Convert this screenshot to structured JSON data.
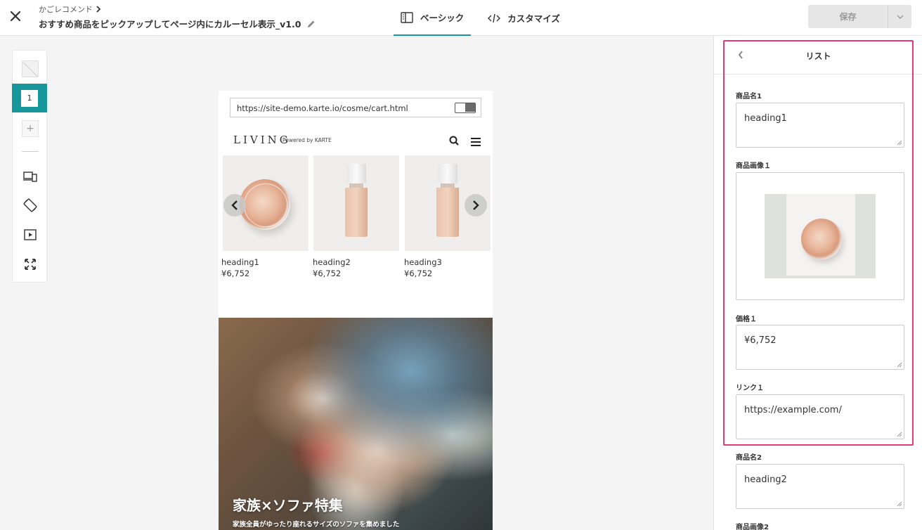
{
  "header": {
    "breadcrumb": "かごレコメンド",
    "title": "おすすめ商品をピックアップしてページ内にカルーセル表示_v1.0",
    "tabs": [
      {
        "label": "ベーシック",
        "icon": "layout-icon",
        "active": true
      },
      {
        "label": "カスタマイズ",
        "icon": "code-icon",
        "active": false
      }
    ],
    "save_label": "保存"
  },
  "left_toolbar": {
    "active_variant": "1",
    "tools": [
      "device-icon",
      "rotate-icon",
      "play-icon",
      "expand-icon"
    ]
  },
  "preview": {
    "url": "https://site-demo.karte.io/cosme/cart.html",
    "logo": "LIVING",
    "powered_by": "Powered by KARTE",
    "products": [
      {
        "name": "heading1",
        "price": "¥6,752",
        "image": "jar"
      },
      {
        "name": "heading2",
        "price": "¥6,752",
        "image": "bottle"
      },
      {
        "name": "heading3",
        "price": "¥6,752",
        "image": "bottle"
      }
    ],
    "hero": {
      "title": "家族×ソファ特集",
      "subtitle": "家族全員がゆったり座れるサイズのソファを集めました"
    }
  },
  "panel": {
    "title": "リスト",
    "fields": [
      {
        "label": "商品名1",
        "value": "heading1"
      },
      {
        "label": "商品画像１",
        "value": ""
      },
      {
        "label": "価格１",
        "value": "¥6,752"
      },
      {
        "label": "リンク１",
        "value": "https://example.com/"
      },
      {
        "label": "商品名2",
        "value": "heading2"
      },
      {
        "label": "商品画像2",
        "value": ""
      }
    ],
    "highlight_color": "#e43a7a"
  },
  "colors": {
    "accent": "#15979b",
    "highlight": "#e43a7a"
  }
}
